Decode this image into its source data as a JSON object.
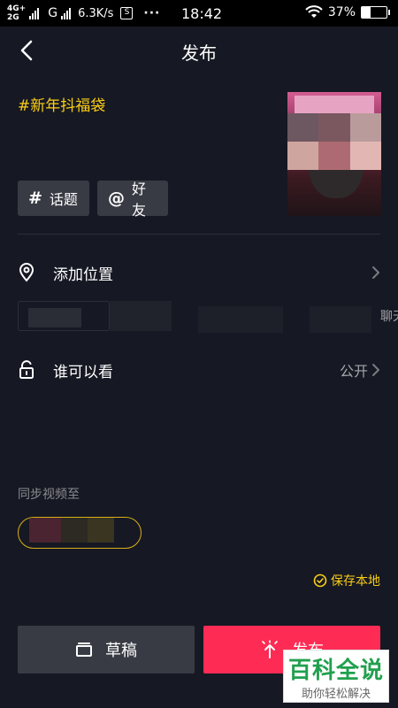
{
  "status_bar": {
    "network_top": "4G+",
    "network_bottom": "2G",
    "second_network": "G",
    "speed": "6.3K/s",
    "s_badge": "S",
    "more": "···",
    "time": "18:42",
    "battery_percent": "37%",
    "battery_level": 0.37
  },
  "nav": {
    "title": "发布",
    "back_icon": "chevron-left-icon"
  },
  "post": {
    "caption": "#新年抖福袋",
    "topic_chip": {
      "symbol": "#",
      "label": "话题"
    },
    "friend_chip": {
      "symbol": "@",
      "label": "好友"
    }
  },
  "location": {
    "label": "添加位置",
    "icon": "location-pin-icon",
    "poi_partial": "聊天"
  },
  "visibility": {
    "label": "谁可以看",
    "value": "公开",
    "icon": "unlock-icon"
  },
  "sync": {
    "label": "同步视频至"
  },
  "save_local": {
    "label": "保存本地",
    "icon": "check-circle-icon"
  },
  "buttons": {
    "draft": {
      "label": "草稿",
      "icon": "drafts-box-icon"
    },
    "publish": {
      "label": "发布",
      "icon": "publish-arrow-icon"
    }
  },
  "watermark": {
    "title": "百科全说",
    "subtitle": "助你轻松解决"
  },
  "colors": {
    "background": "#161823",
    "accent_yellow": "#face15",
    "publish_red": "#fe2c55",
    "chip_gray": "#393b44",
    "watermark_green": "#21a04e"
  }
}
